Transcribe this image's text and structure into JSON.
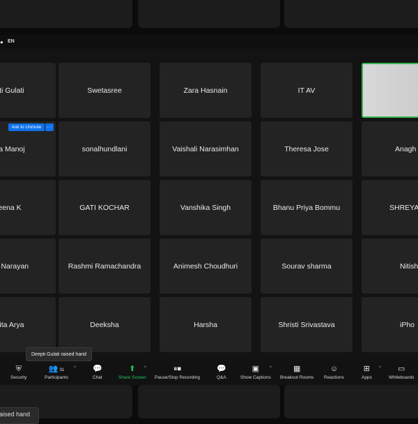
{
  "topbar": {
    "lang": "EN"
  },
  "grid": {
    "rows": [
      [
        "pti Gulati",
        "Swetasree",
        "Zara Hasnain",
        "IT AV",
        ""
      ],
      [
        "na Manoj",
        "sonalhundlani",
        "Vaishali Narasimhan",
        "Theresa Jose",
        "Anagh"
      ],
      [
        "eena K",
        "GATI KOCHAR",
        "Vanshika Singh",
        "Bhanu Priya Bommu",
        "SHREYA"
      ],
      [
        "ha Narayan",
        "Rashmi Ramachandra",
        "Animesh Choudhuri",
        "Sourav sharma",
        "Nitish"
      ],
      [
        "hita Arya",
        "Deeksha",
        "Harsha",
        "Shristi Srivastava",
        "iPho"
      ]
    ]
  },
  "unmute": {
    "label": "Ask to Unmute",
    "more": "···"
  },
  "tooltip": {
    "text": "Deepti Gulati raised hand"
  },
  "toolbar": {
    "security": "Security",
    "participants": "Participants",
    "participants_count": "31",
    "chat": "Chat",
    "share_screen": "Share Screen",
    "pause_stop": "Pause/Stop Recording",
    "qa": "Q&A",
    "captions": "Show Captions",
    "breakout": "Breakout Rooms",
    "reactions": "Reactions",
    "apps": "Apps",
    "whiteboards": "Whiteboards"
  },
  "bottom_notice": {
    "text": "aised hand"
  },
  "colors": {
    "accent": "#0e71eb",
    "share_green": "#22c55e",
    "tile": "#232323"
  }
}
